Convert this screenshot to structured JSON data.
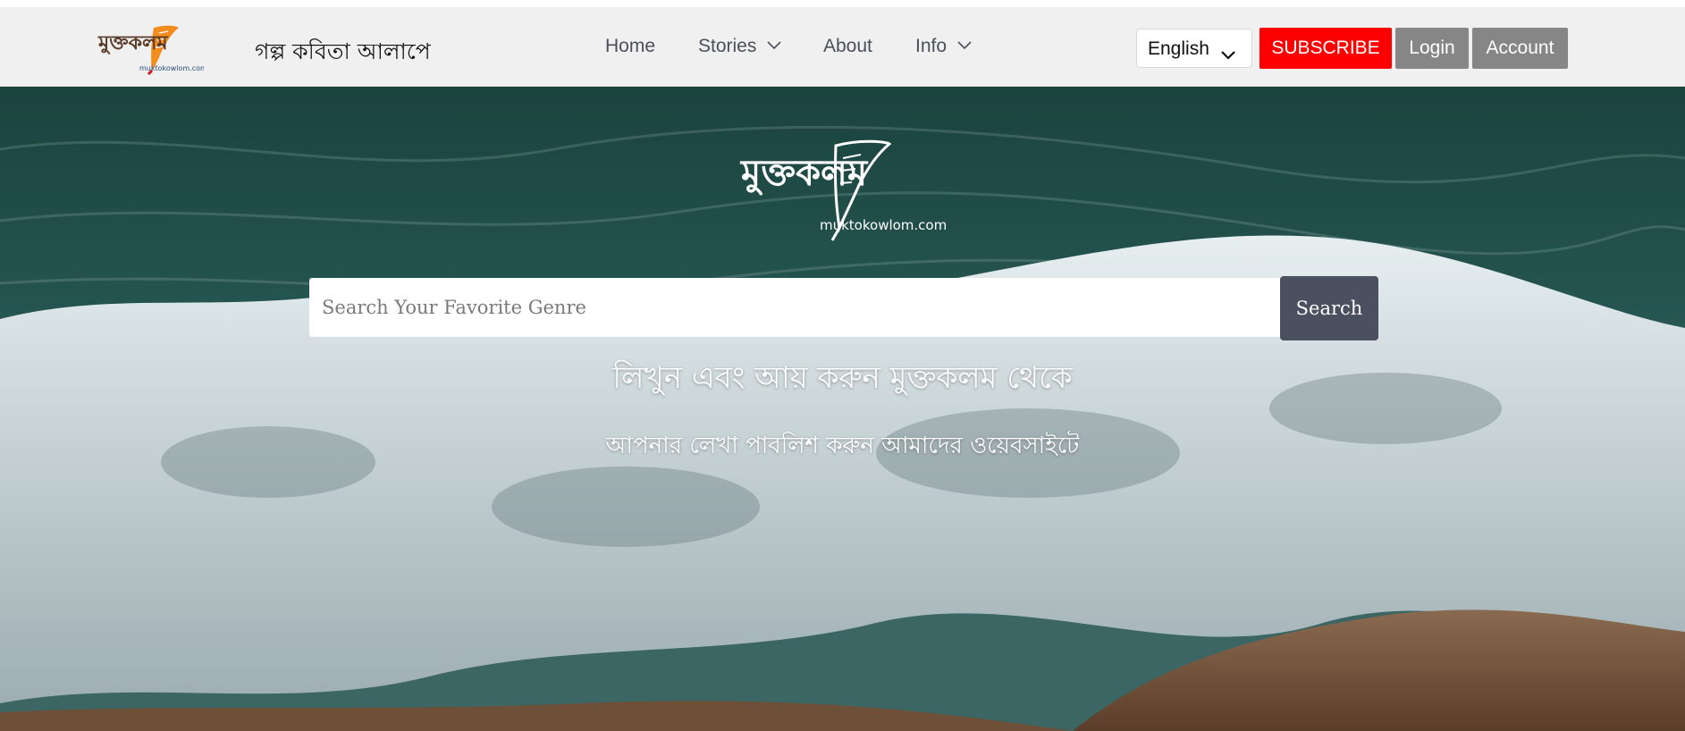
{
  "header": {
    "logo": {
      "text": "মুক্তকলম",
      "domain": "muktokowlom.com"
    },
    "tagline": "গল্প কবিতা আলাপে",
    "nav": [
      {
        "label": "Home",
        "dropdown": false
      },
      {
        "label": "Stories",
        "dropdown": true
      },
      {
        "label": "About",
        "dropdown": false
      },
      {
        "label": "Info",
        "dropdown": true
      }
    ],
    "language": {
      "selected": "English"
    },
    "subscribe_label": "SUBSCRIBE",
    "login_label": "Login",
    "account_label": "Account"
  },
  "hero": {
    "logo": {
      "text": "মুক্তকলম",
      "domain": "muktokowlom.com"
    },
    "search": {
      "placeholder": "Search Your Favorite Genre",
      "value": "",
      "button_label": "Search"
    },
    "title": "লিখুন এবং আয় করুন মুক্তকলম থেকে",
    "subtitle": "আপনার লেখা পাবলিশ করুন আমাদের ওয়েবসাইটে"
  },
  "icons": {
    "nav_dropdown": "chevron-down-icon",
    "language_dropdown": "chevron-down-icon",
    "logo_feather": "feather-pen-icon"
  },
  "colors": {
    "navbar_bg": "#f0f0f0",
    "subscribe": "#ff0000",
    "login": "#868686",
    "account": "#868686",
    "search_button": "#4a5060",
    "logo_brown": "#5a3a28",
    "logo_orange": "#f28c1c"
  }
}
